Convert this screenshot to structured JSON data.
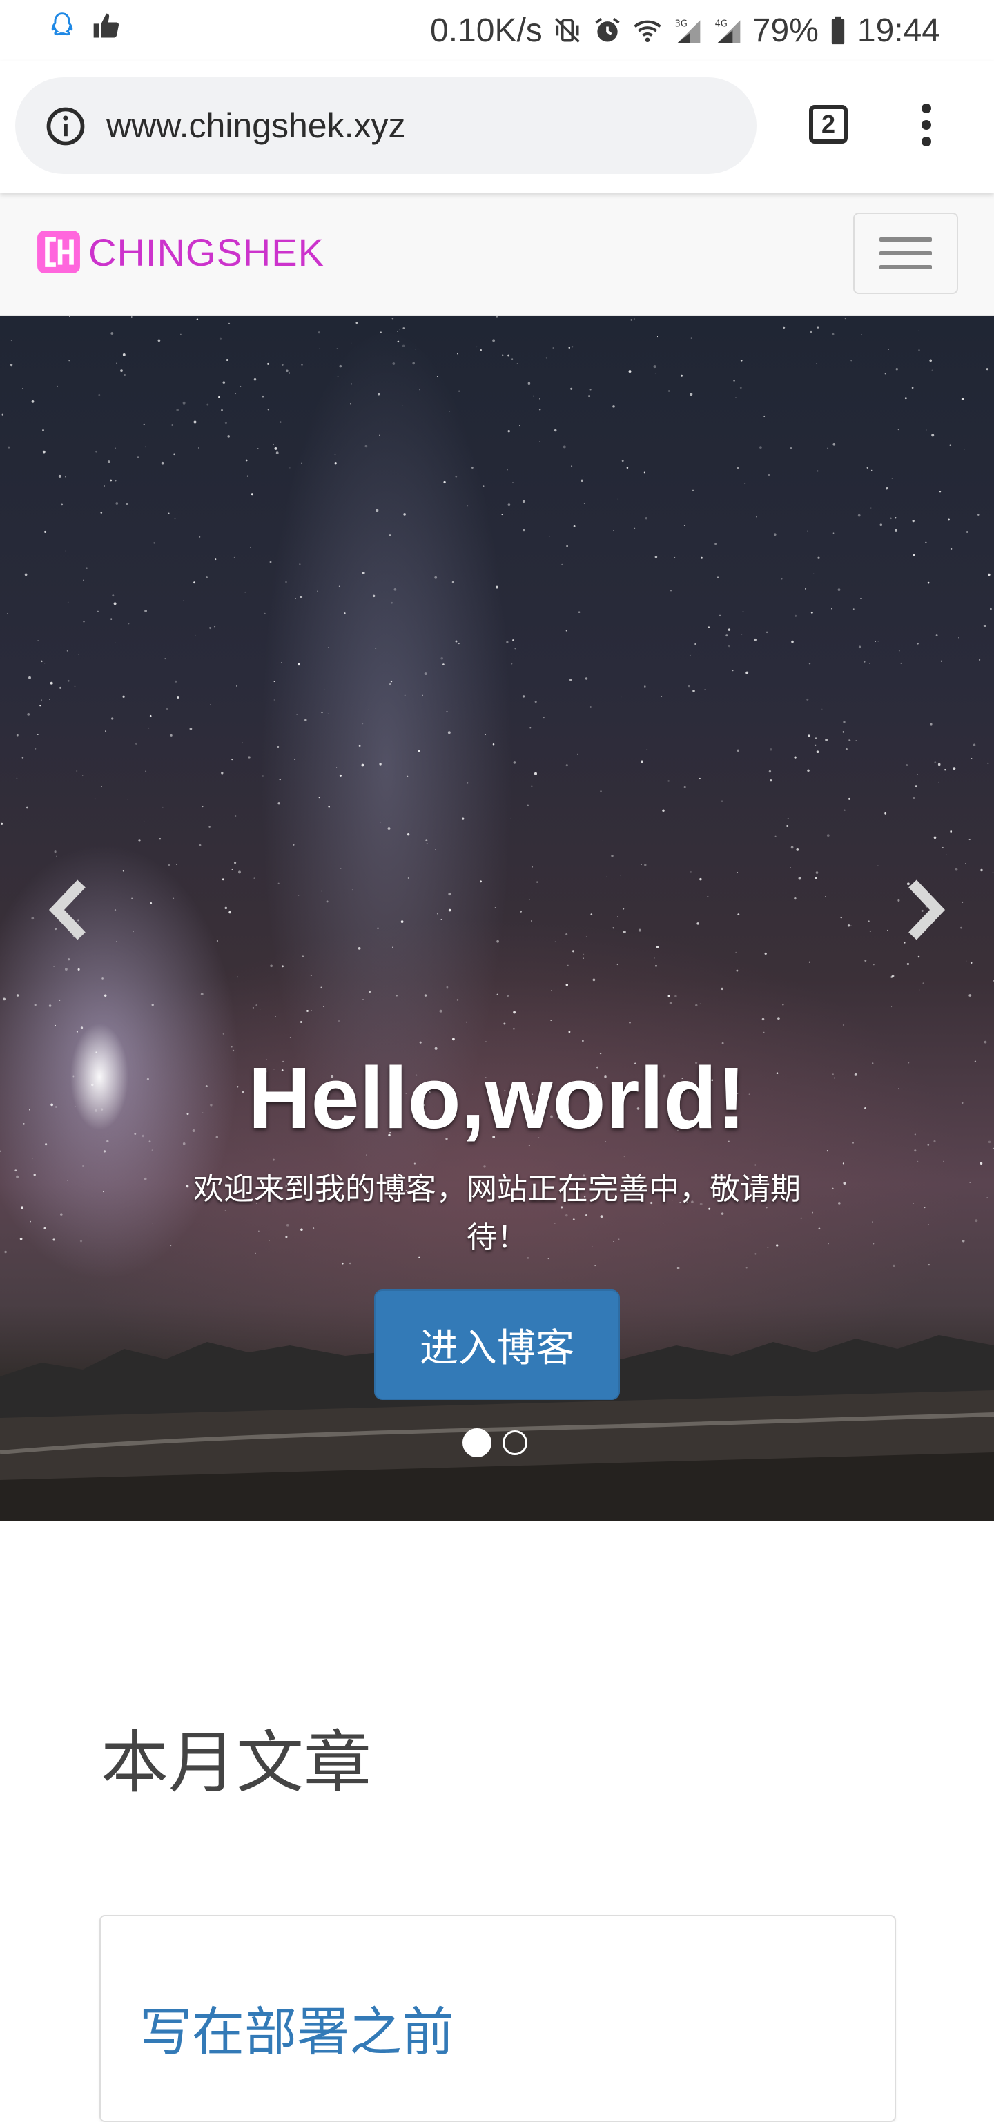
{
  "status_bar": {
    "speed": "0.10K/s",
    "battery": "79%",
    "time": "19:44",
    "icons": [
      "qq-icon",
      "thumbs-up-icon",
      "mute-vibrate-icon",
      "alarm-icon",
      "wifi-icon",
      "signal-3g-icon",
      "signal-4g-icon",
      "battery-icon"
    ]
  },
  "browser": {
    "url": "www.chingshek.xyz",
    "tab_count": "2"
  },
  "navbar": {
    "brand": "CHINGSHEK",
    "brand_color": "#cc33cc"
  },
  "carousel": {
    "title": "Hello,world!",
    "subtitle": "欢迎来到我的博客，网站正在完善中，敬请期待！",
    "button": "进入博客",
    "button_color": "#337ab7",
    "slides": 2,
    "active_slide": 1
  },
  "content": {
    "section_title": "本月文章",
    "first_article": "写在部署之前"
  }
}
